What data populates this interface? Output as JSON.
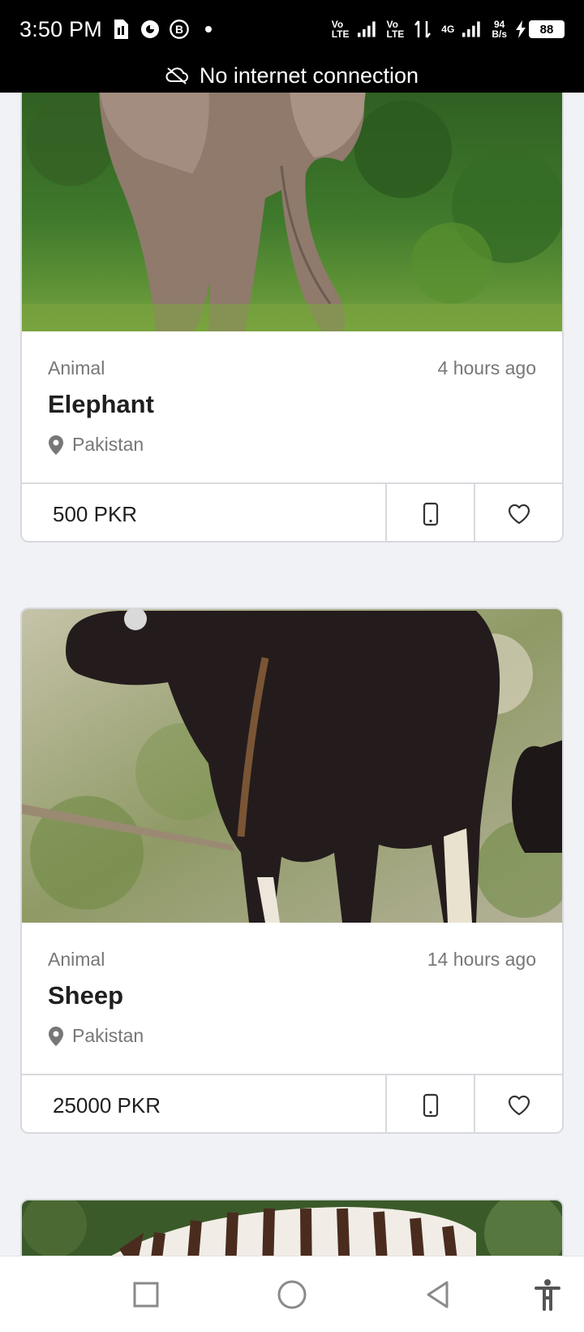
{
  "status_bar": {
    "time": "3:50 PM",
    "net1": "Vo\nLTE",
    "net2": "Vo\nLTE",
    "net3": "4G",
    "speed_value": "94",
    "speed_unit": "B/s",
    "battery": "88"
  },
  "banner": {
    "text": "No internet connection",
    "icon": "cloud-off-icon"
  },
  "listings": [
    {
      "category": "Animal",
      "time": "4 hours ago",
      "title": "Elephant",
      "location": "Pakistan",
      "price": "500 PKR",
      "photo": "elephant"
    },
    {
      "category": "Animal",
      "time": "14 hours ago",
      "title": "Sheep",
      "location": "Pakistan",
      "price": "25000 PKR",
      "photo": "sheep"
    },
    {
      "photo": "zebra"
    }
  ],
  "colors": {
    "background": "#f1f2f6",
    "text_primary": "#1f1f1f",
    "text_secondary": "#777777",
    "border": "#d8d9de"
  },
  "nav": {
    "icons": [
      "recents-square-icon",
      "home-circle-icon",
      "back-triangle-icon",
      "accessibility-icon"
    ]
  }
}
